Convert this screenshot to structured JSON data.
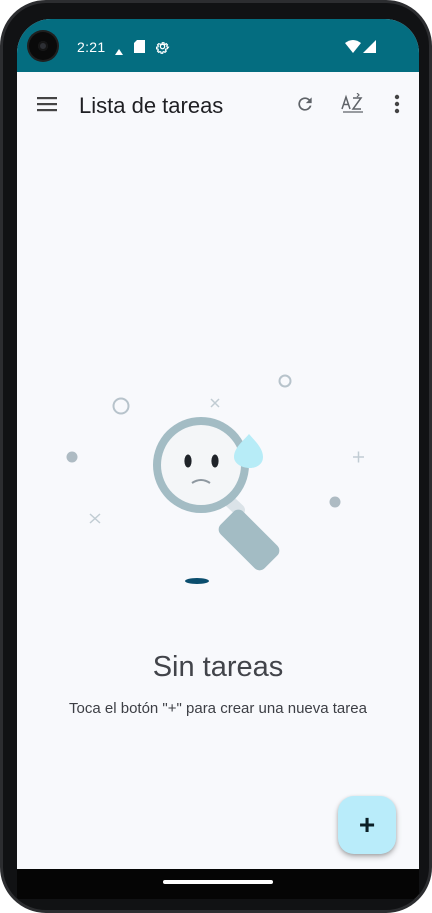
{
  "status_bar": {
    "time": "2:21",
    "background_color": "#046d80",
    "icons": [
      "notification-icon",
      "sd-card-icon",
      "settings-icon",
      "wifi-icon",
      "cell-signal-icon"
    ]
  },
  "app_bar": {
    "title": "Lista de tareas",
    "actions": [
      "menu-icon",
      "refresh-icon",
      "sort-az-icon",
      "more-vert-icon"
    ]
  },
  "empty_state": {
    "title": "Sin tareas",
    "subtitle": "Toca el botón \"+\" para crear una nueva tarea"
  },
  "fab": {
    "label": "+",
    "color": "#b9ecfa"
  }
}
